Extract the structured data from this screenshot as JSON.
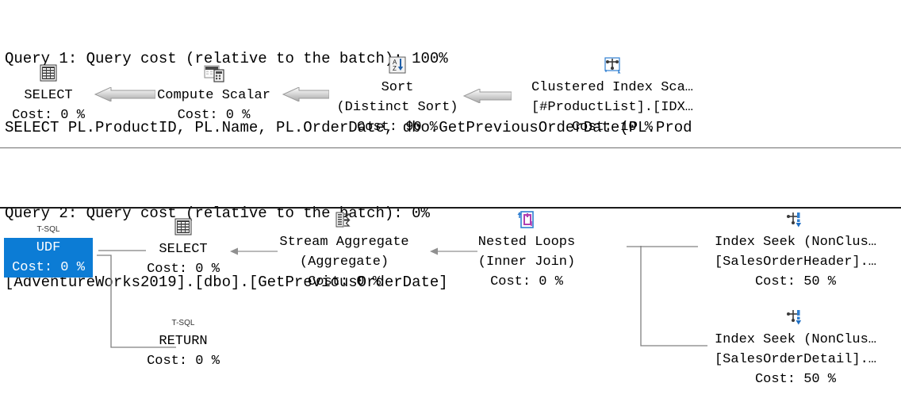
{
  "app": {
    "kind": "sql-execution-plan",
    "selection_color": "#0c7cd5"
  },
  "query1": {
    "header_line1": "Query 1: Query cost (relative to the batch): 100%",
    "header_line2": "SELECT PL.ProductID, PL.Name, PL.OrderDate, dbo.GetPreviousOrderDate(PL.Prod",
    "nodes": [
      {
        "id": "select",
        "icon": "result-grid-icon",
        "label": "SELECT",
        "sub": "",
        "cost": "Cost: 0 %"
      },
      {
        "id": "compute-scalar",
        "icon": "compute-scalar-icon",
        "label": "Compute Scalar",
        "sub": "",
        "cost": "Cost: 0 %"
      },
      {
        "id": "sort",
        "icon": "sort-az-icon",
        "label": "Sort",
        "sub": "(Distinct Sort)",
        "cost": "Cost: 90 %"
      },
      {
        "id": "clustered-index-scan",
        "icon": "clustered-index-scan-icon",
        "label": "Clustered Index Sca…",
        "sub": "[#ProductList].[IDX…",
        "cost": "Cost: 10 %"
      }
    ]
  },
  "query2": {
    "header_line1": "Query 2: Query cost (relative to the batch): 0%",
    "header_line2": "[AdventureWorks2019].[dbo].[GetPreviousOrderDate]",
    "nodes": [
      {
        "id": "udf",
        "icon": "tsql-badge",
        "badge": "T-SQL",
        "label": "UDF",
        "sub": "",
        "cost": "Cost: 0 %",
        "selected": true
      },
      {
        "id": "select",
        "icon": "result-grid-icon",
        "label": "SELECT",
        "sub": "",
        "cost": "Cost: 0 %"
      },
      {
        "id": "stream-aggregate",
        "icon": "stream-aggregate-icon",
        "label": "Stream Aggregate",
        "sub": "(Aggregate)",
        "cost": "Cost: 0 %"
      },
      {
        "id": "nested-loops",
        "icon": "nested-loops-icon",
        "label": "Nested Loops",
        "sub": "(Inner Join)",
        "cost": "Cost: 0 %"
      },
      {
        "id": "index-seek-header",
        "icon": "index-seek-icon",
        "label": "Index Seek (NonClus…",
        "sub": "[SalesOrderHeader].…",
        "cost": "Cost: 50 %"
      },
      {
        "id": "index-seek-detail",
        "icon": "index-seek-icon",
        "label": "Index Seek (NonClus…",
        "sub": "[SalesOrderDetail].…",
        "cost": "Cost: 50 %"
      },
      {
        "id": "return",
        "icon": "tsql-badge",
        "badge": "T-SQL",
        "label": "RETURN",
        "sub": "",
        "cost": "Cost: 0 %"
      }
    ]
  }
}
